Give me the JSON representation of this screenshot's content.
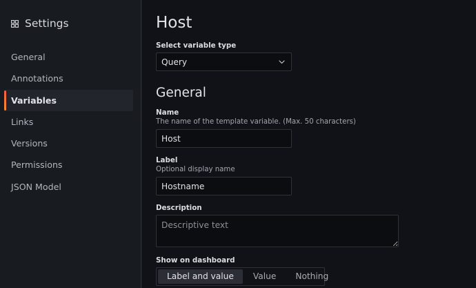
{
  "sidebar": {
    "title": "Settings",
    "title_icon": "grid-icon",
    "items": [
      {
        "label": "General",
        "active": false
      },
      {
        "label": "Annotations",
        "active": false
      },
      {
        "label": "Variables",
        "active": true
      },
      {
        "label": "Links",
        "active": false
      },
      {
        "label": "Versions",
        "active": false
      },
      {
        "label": "Permissions",
        "active": false
      },
      {
        "label": "JSON Model",
        "active": false
      }
    ]
  },
  "main": {
    "title": "Host",
    "variable_type": {
      "label": "Select variable type",
      "value": "Query",
      "icon": "chevron-down-icon"
    },
    "general_section": {
      "title": "General",
      "name": {
        "label": "Name",
        "help": "The name of the template variable. (Max. 50 characters)",
        "value": "Host"
      },
      "label_field": {
        "label": "Label",
        "help": "Optional display name",
        "value": "Hostname"
      },
      "description": {
        "label": "Description",
        "placeholder": "Descriptive text",
        "value": ""
      },
      "show_on_dashboard": {
        "label": "Show on dashboard",
        "options": [
          "Label and value",
          "Value",
          "Nothing"
        ],
        "selected": "Label and value"
      }
    }
  },
  "colors": {
    "sidebar_bg": "#181b1f",
    "main_bg": "#111217",
    "active_item_bg": "#22252b",
    "accent_gradient_start": "#f55f3e",
    "accent_gradient_end": "#ff8833",
    "input_bg": "#0c0d11",
    "border": "#2f3237"
  }
}
